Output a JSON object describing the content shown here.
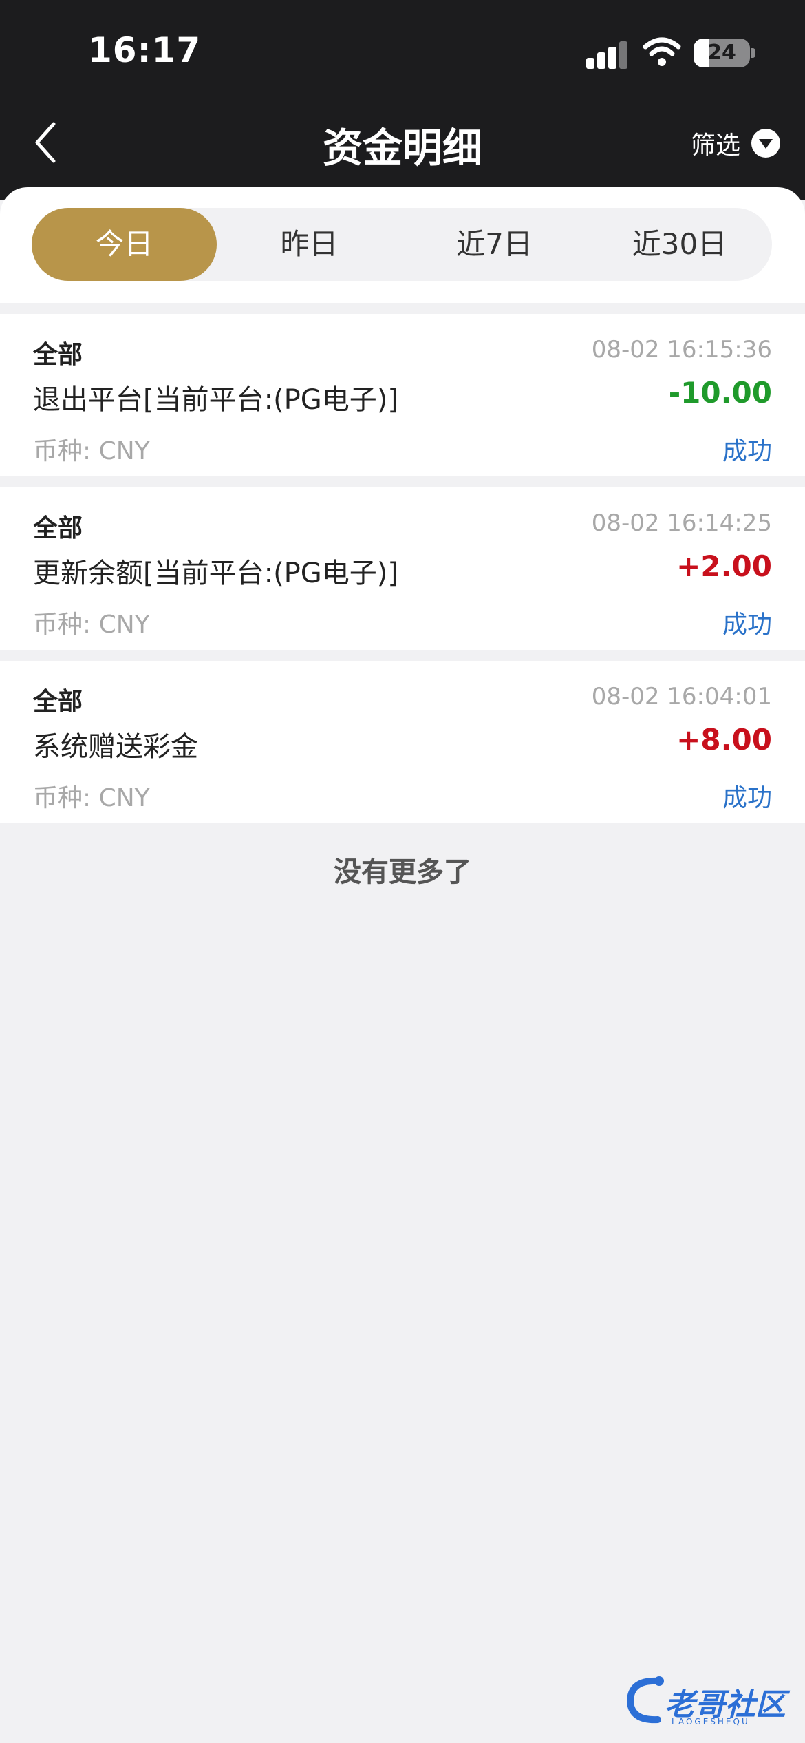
{
  "status_bar": {
    "time": "16:17",
    "battery": "24"
  },
  "header": {
    "title": "资金明细",
    "filter_label": "筛选"
  },
  "tabs": [
    {
      "label": "今日",
      "active": true
    },
    {
      "label": "昨日",
      "active": false
    },
    {
      "label": "近7日",
      "active": false
    },
    {
      "label": "近30日",
      "active": false
    }
  ],
  "records": [
    {
      "category": "全部",
      "time": "08-02 16:15:36",
      "description": "退出平台[当前平台:(PG电子)]",
      "amount": "-10.00",
      "currency": "币种: CNY",
      "status": "成功"
    },
    {
      "category": "全部",
      "time": "08-02 16:14:25",
      "description": "更新余额[当前平台:(PG电子)]",
      "amount": "+2.00",
      "currency": "币种: CNY",
      "status": "成功"
    },
    {
      "category": "全部",
      "time": "08-02 16:04:01",
      "description": "系统赠送彩金",
      "amount": "+8.00",
      "currency": "币种: CNY",
      "status": "成功"
    }
  ],
  "footer": {
    "no_more": "没有更多了"
  },
  "watermark": {
    "text": "老哥社区",
    "sub": "LAOGESHEQU"
  },
  "colors": {
    "accent": "#b8954a",
    "negative": "#1f9a2b",
    "positive": "#c8101c",
    "status": "#2a72c9",
    "header_bg": "#1c1c1e"
  }
}
